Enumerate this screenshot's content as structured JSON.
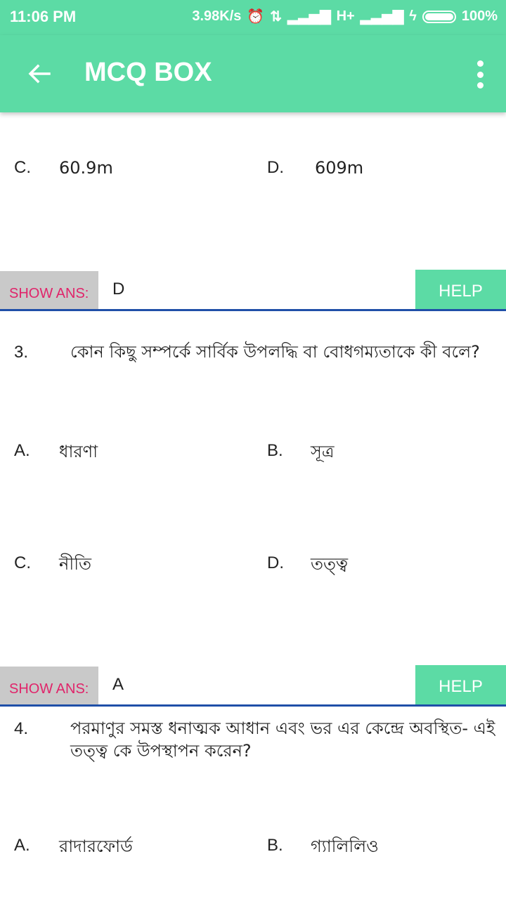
{
  "status_bar": {
    "time": "11:06 PM",
    "speed": "3.98K/s",
    "network": "H+",
    "battery": "100%"
  },
  "app_bar": {
    "title": "MCQ BOX",
    "back_icon": "arrow-left-icon",
    "menu_icon": "more-vert-icon"
  },
  "colors": {
    "primary": "#5cdba5",
    "show_ans_bg": "#c9c9c9",
    "show_ans_text": "#e0246a",
    "divider": "#1f4fa8"
  },
  "questions": [
    {
      "options": [
        {
          "label": "C.",
          "text": "60.9m"
        },
        {
          "label": "D.",
          "text": "609m"
        }
      ],
      "show_ans_label": "SHOW ANS:",
      "answer": "D",
      "help_label": "HELP"
    },
    {
      "number": "3.",
      "text": "কোন কিছু সম্পর্কে সার্বিক উপলদ্ধি বা বোধগম্যতাকে কী বলে?",
      "options": [
        {
          "label": "A.",
          "text": "ধারণা"
        },
        {
          "label": "B.",
          "text": "সূত্র"
        },
        {
          "label": "C.",
          "text": "নীতি"
        },
        {
          "label": "D.",
          "text": "তত্ত্ব"
        }
      ],
      "show_ans_label": "SHOW ANS:",
      "answer": "A",
      "help_label": "HELP"
    },
    {
      "number": "4.",
      "text": "পরমাণুর সমস্ত ধনাত্মক আধান এবং ভর এর কেন্দ্রে অবস্থিত- এই তত্ত্ব কে উপস্থাপন করেন?",
      "options": [
        {
          "label": "A.",
          "text": "রাদারফোর্ড"
        },
        {
          "label": "B.",
          "text": "গ্যালিলিও"
        }
      ]
    }
  ]
}
